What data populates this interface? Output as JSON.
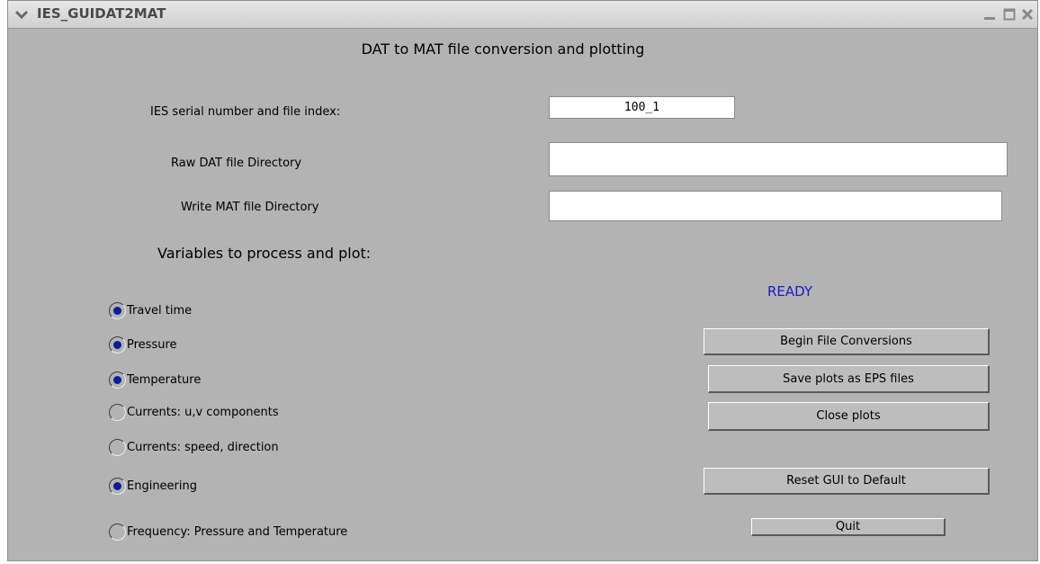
{
  "window": {
    "title": "IES_GUIDAT2MAT",
    "controls": [
      "chevron-down-icon",
      "minimize-icon",
      "maximize-icon",
      "close-icon"
    ]
  },
  "heading": "DAT to MAT file conversion and plotting",
  "fields": {
    "serial_label": "IES serial number and file index:",
    "serial_value": "100_1",
    "raw_dir_label": "Raw DAT file Directory",
    "raw_dir_value": "",
    "write_dir_label": "Write MAT file Directory",
    "write_dir_value": ""
  },
  "variables_heading": "Variables to process and plot:",
  "status": "READY",
  "status_color": "#1a1ad0",
  "options": [
    {
      "label": "Travel time",
      "checked": true
    },
    {
      "label": "Pressure",
      "checked": true
    },
    {
      "label": "Temperature",
      "checked": true
    },
    {
      "label": "Currents: u,v components",
      "checked": false
    },
    {
      "label": "Currents: speed, direction",
      "checked": false
    },
    {
      "label": "Engineering",
      "checked": true
    },
    {
      "label": "Frequency: Pressure and Temperature",
      "checked": false
    }
  ],
  "buttons": {
    "begin": "Begin File Conversions",
    "save_eps": "Save plots as EPS files",
    "close_plots": "Close plots",
    "reset": "Reset GUI to Default",
    "quit": "Quit"
  }
}
